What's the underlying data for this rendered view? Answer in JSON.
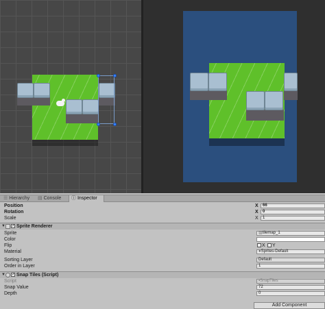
{
  "tabs": [
    {
      "label": "Hierarchy",
      "active": false
    },
    {
      "label": "Console",
      "active": false
    },
    {
      "label": "Inspector",
      "active": true
    }
  ],
  "transform": {
    "position": {
      "label": "Position",
      "axis": "X",
      "value": "66"
    },
    "rotation": {
      "label": "Rotation",
      "axis": "X",
      "value": "0"
    },
    "scale": {
      "label": "Scale",
      "axis": "X",
      "value": "1"
    }
  },
  "sprite_renderer": {
    "title": "Sprite Renderer",
    "enabled": true,
    "sprite": {
      "label": "Sprite",
      "value": "tilemap_1"
    },
    "color": {
      "label": "Color",
      "value": "#ffffff"
    },
    "flip": {
      "label": "Flip",
      "x": "X",
      "y": "Y"
    },
    "material": {
      "label": "Material",
      "value": "Sprites-Default"
    },
    "sorting_layer": {
      "label": "Sorting Layer",
      "value": "Default"
    },
    "order_in_layer": {
      "label": "Order in Layer",
      "value": "1"
    }
  },
  "snap_tiles": {
    "title": "Snap Tiles (Script)",
    "enabled": true,
    "script": {
      "label": "Script",
      "value": "SnapTiles"
    },
    "snap_value": {
      "label": "Snap Value",
      "value": "72"
    },
    "depth": {
      "label": "Depth",
      "value": "0"
    }
  },
  "add_component": "Add Component",
  "colors": {
    "scene_bg": "#474747",
    "game_bg": "#2f2f2f",
    "camera_blue": "#2b4f7e",
    "grass": "#5fc02a",
    "rock": "#a9bfd1",
    "handle": "#3a86ff"
  }
}
